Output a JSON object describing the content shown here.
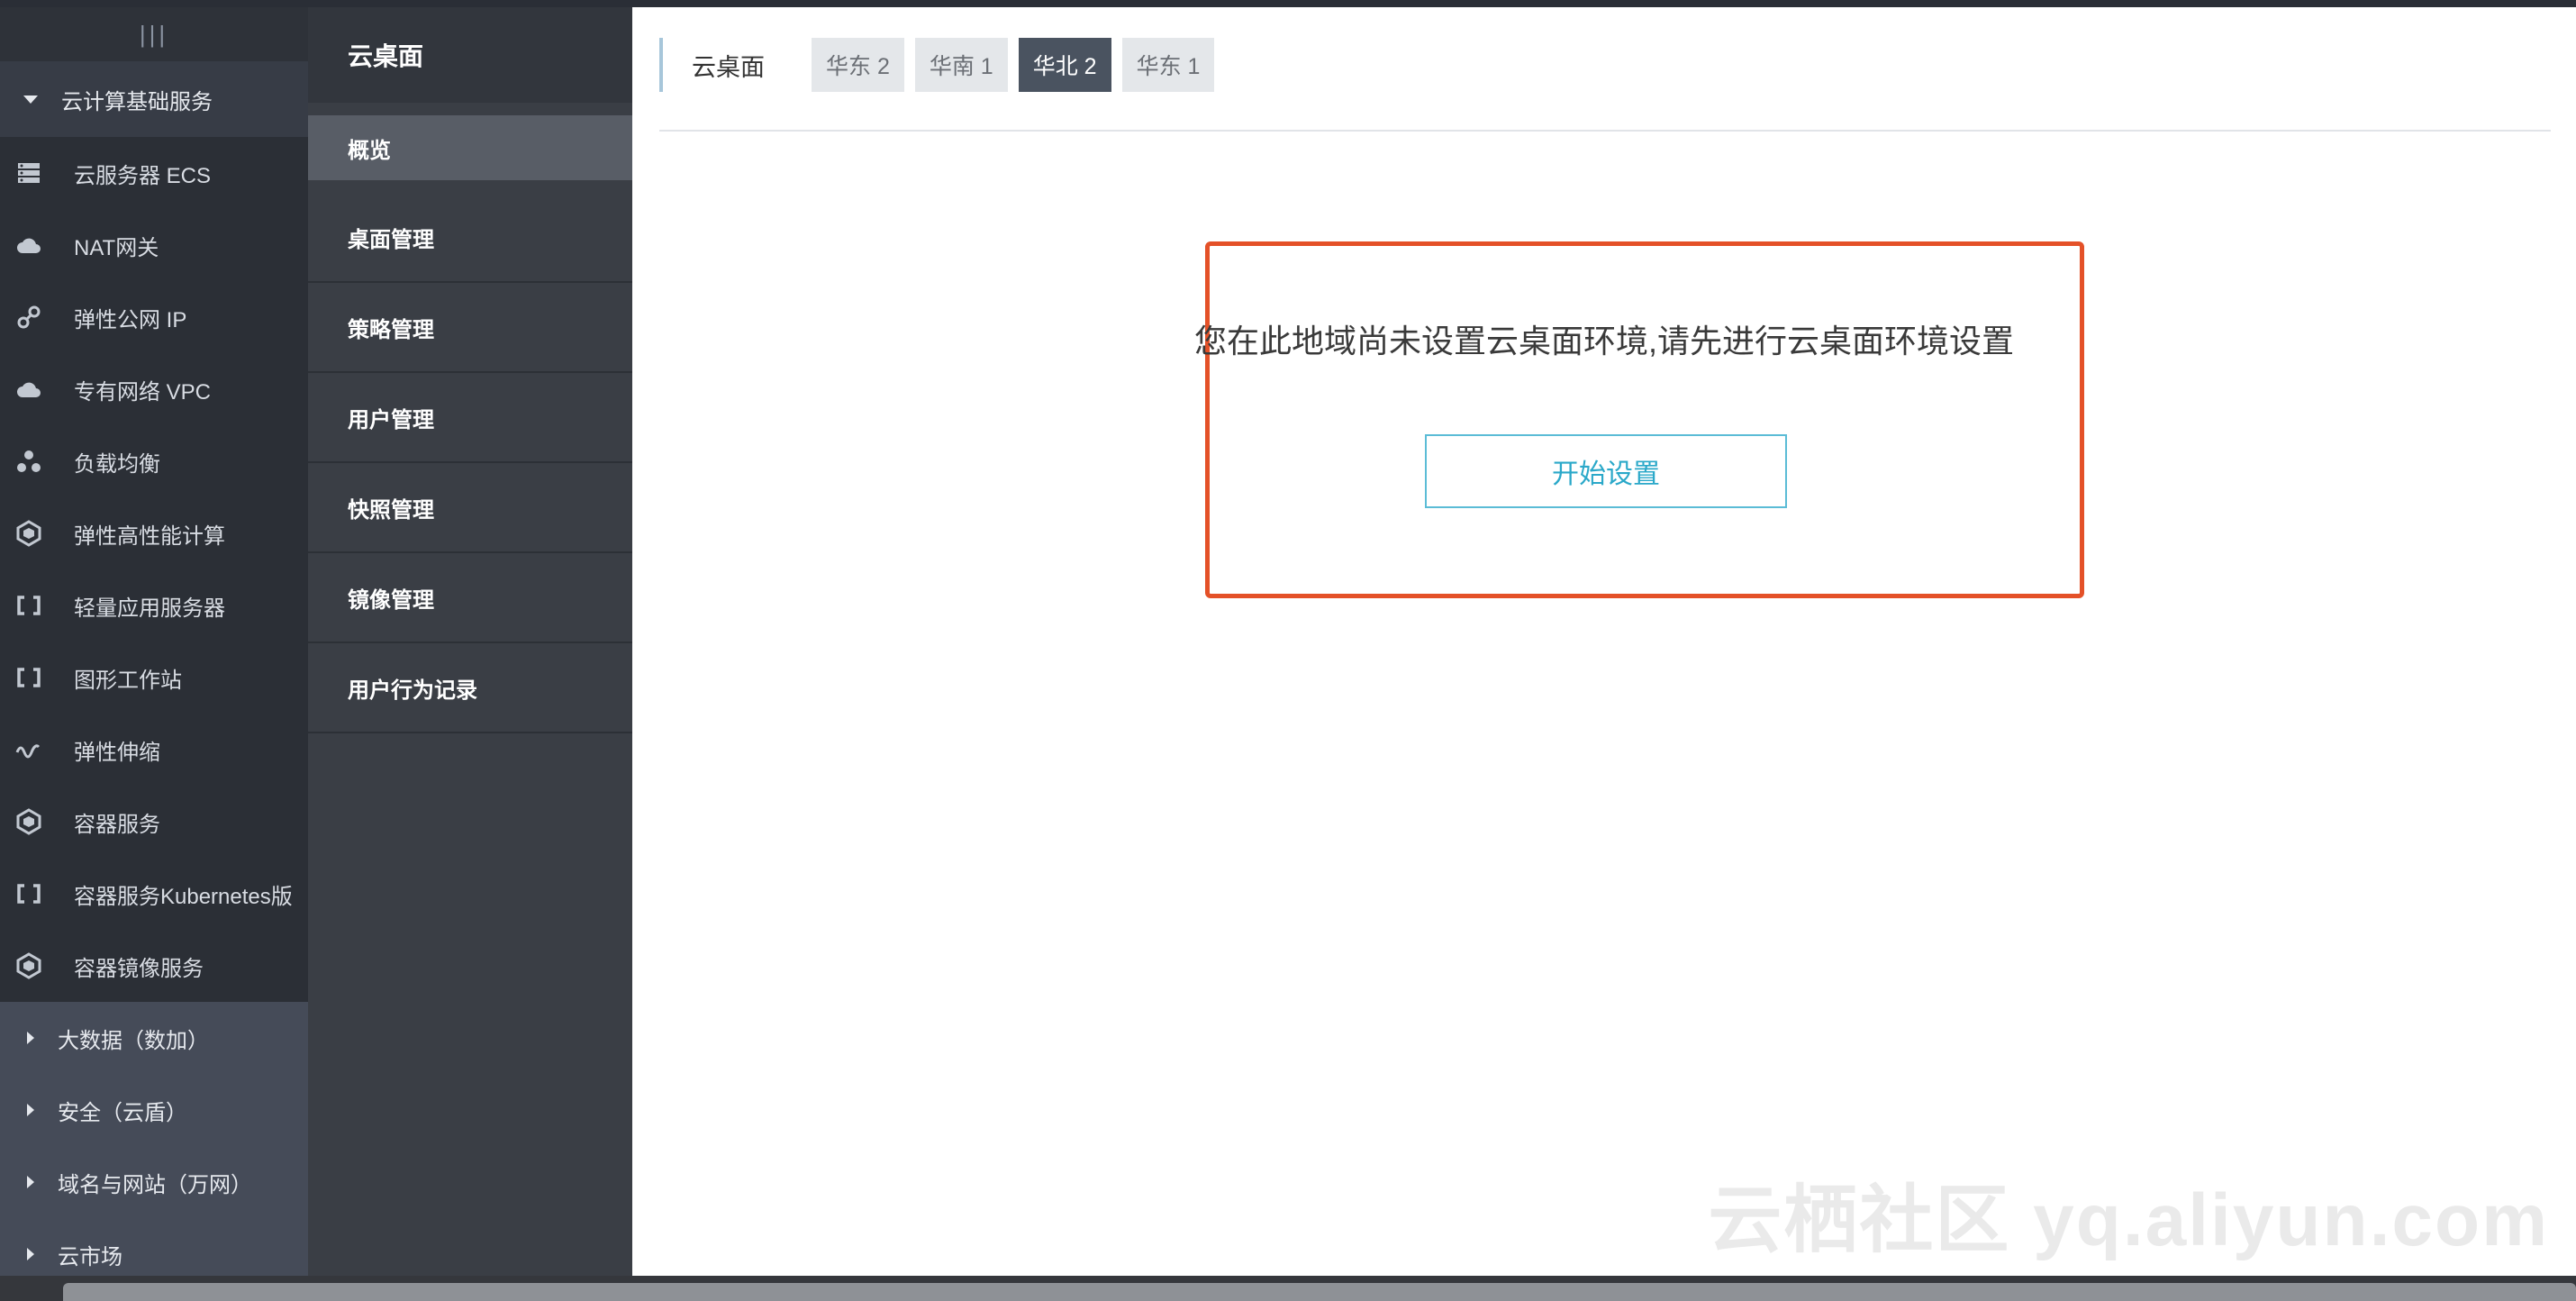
{
  "left_nav": {
    "handle": "|||",
    "expanded_group": "云计算基础服务",
    "items": [
      {
        "label": "云服务器 ECS",
        "icon": "server-icon"
      },
      {
        "label": "NAT网关",
        "icon": "cloud-icon"
      },
      {
        "label": "弹性公网 IP",
        "icon": "link-icon"
      },
      {
        "label": "专有网络 VPC",
        "icon": "cloud-icon"
      },
      {
        "label": "负载均衡",
        "icon": "nodes-icon"
      },
      {
        "label": "弹性高性能计算",
        "icon": "hexagon-icon"
      },
      {
        "label": "轻量应用服务器",
        "icon": "bracket-icon"
      },
      {
        "label": "图形工作站",
        "icon": "bracket-icon"
      },
      {
        "label": "弹性伸缩",
        "icon": "wave-icon"
      },
      {
        "label": "容器服务",
        "icon": "hexagon-icon"
      },
      {
        "label": "容器服务Kubernetes版",
        "icon": "bracket-icon"
      },
      {
        "label": "容器镜像服务",
        "icon": "hexagon-icon"
      }
    ],
    "collapsed_groups": [
      "大数据（数加）",
      "安全（云盾）",
      "域名与网站（万网）",
      "云市场"
    ]
  },
  "sub_nav": {
    "title": "云桌面",
    "items": [
      "概览",
      "桌面管理",
      "策略管理",
      "用户管理",
      "快照管理",
      "镜像管理",
      "用户行为记录"
    ],
    "active_index": 0
  },
  "main": {
    "region_title": "云桌面",
    "regions": [
      "华东 2",
      "华南 1",
      "华北 2",
      "华东 1"
    ],
    "active_region": "华北 2",
    "notice": "您在此地域尚未设置云桌面环境,请先进行云桌面环境设置",
    "start_button": "开始设置"
  },
  "watermark": "云栖社区 yq.aliyun.com",
  "colors": {
    "highlight_border": "#e45128",
    "button_accent": "#2aa8c9",
    "active_tab": "#4a5360"
  }
}
